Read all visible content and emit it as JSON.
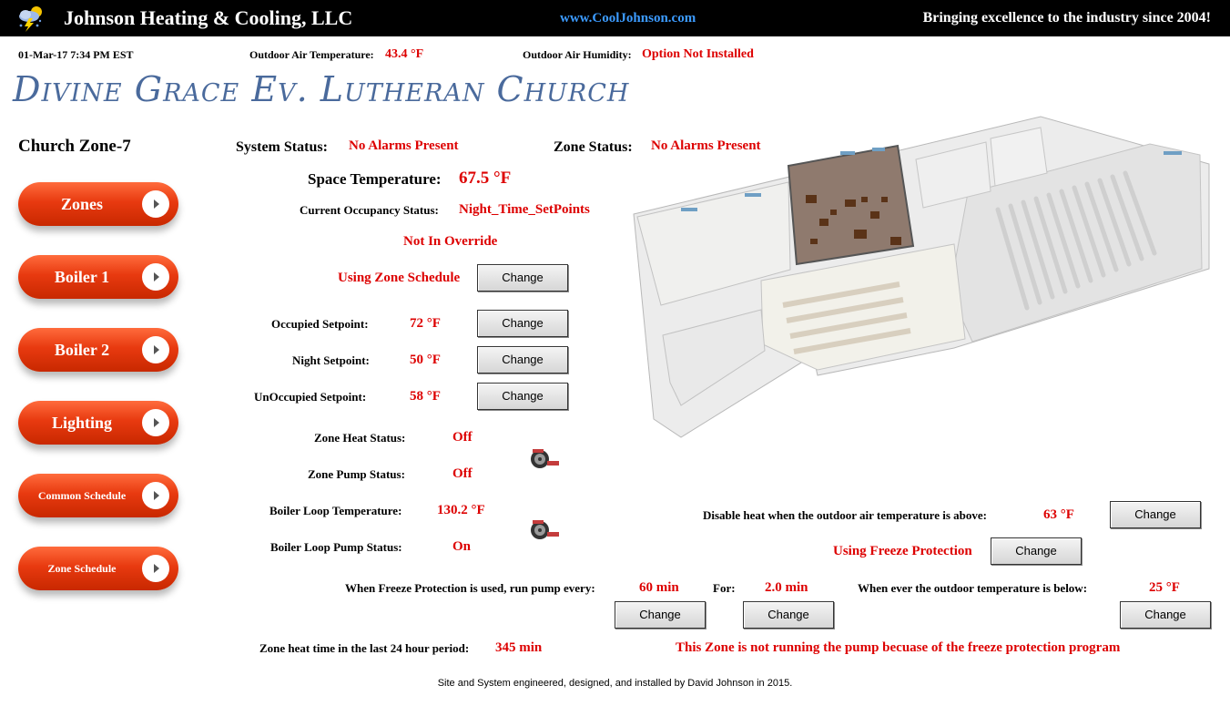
{
  "header": {
    "company": "Johnson Heating & Cooling, LLC",
    "website": "www.CoolJohnson.com",
    "slogan": "Bringing excellence to the industry since 2004!",
    "logo_icon": "weather-lightning-icon"
  },
  "info_bar": {
    "datetime": "01-Mar-17 7:34 PM EST",
    "oat_label": "Outdoor Air Temperature:",
    "oat_value": "43.4 °F",
    "oah_label": "Outdoor Air Humidity:",
    "oah_value": "Option Not Installed"
  },
  "church_name": "Divine Grace Ev. Lutheran Church",
  "zone_title": "Church Zone-7",
  "nav": [
    {
      "label": "Zones"
    },
    {
      "label": "Boiler 1"
    },
    {
      "label": "Boiler 2"
    },
    {
      "label": "Lighting"
    },
    {
      "label": "Common Schedule"
    },
    {
      "label": "Zone Schedule"
    }
  ],
  "status": {
    "system_label": "System Status:",
    "system_value": "No Alarms Present",
    "zone_label": "Zone Status:",
    "zone_value": "No Alarms Present",
    "space_temp_label": "Space Temperature:",
    "space_temp_value": "67.5 °F",
    "occupancy_label": "Current Occupancy Status:",
    "occupancy_value": "Night_Time_SetPoints",
    "override": "Not In Override",
    "schedule": "Using Zone Schedule"
  },
  "setpoints": {
    "occupied_label": "Occupied Setpoint:",
    "occupied_value": "72 °F",
    "night_label": "Night Setpoint:",
    "night_value": "50 °F",
    "unoccupied_label": "UnOccupied Setpoint:",
    "unoccupied_value": "58 °F"
  },
  "pumps": {
    "heat_label": "Zone Heat Status:",
    "heat_value": "Off",
    "pump_label": "Zone Pump Status:",
    "pump_value": "Off",
    "loop_temp_label": "Boiler Loop Temperature:",
    "loop_temp_value": "130.2 °F",
    "loop_pump_label": "Boiler Loop Pump Status:",
    "loop_pump_value": "On"
  },
  "freeze": {
    "disable_label": "Disable heat when the outdoor air temperature is above:",
    "disable_value": "63 °F",
    "using": "Using Freeze Protection",
    "run_label": "When Freeze Protection is used, run pump every:",
    "run_value": "60 min",
    "for_label": "For:",
    "for_value": "2.0 min",
    "below_label": "When ever the outdoor temperature is below:",
    "below_value": "25 °F",
    "heat_time_label": "Zone heat time in the last 24 hour period:",
    "heat_time_value": "345 min",
    "message": "This Zone is not running the pump becuase of the freeze protection program"
  },
  "change_label": "Change",
  "footer": "Site and System engineered, designed, and installed by David Johnson in 2015.",
  "colors": {
    "accent_red": "#dd0000",
    "nav_orange": "#e83a10",
    "title_blue": "#4a6a9c",
    "header_bg": "#000000"
  }
}
